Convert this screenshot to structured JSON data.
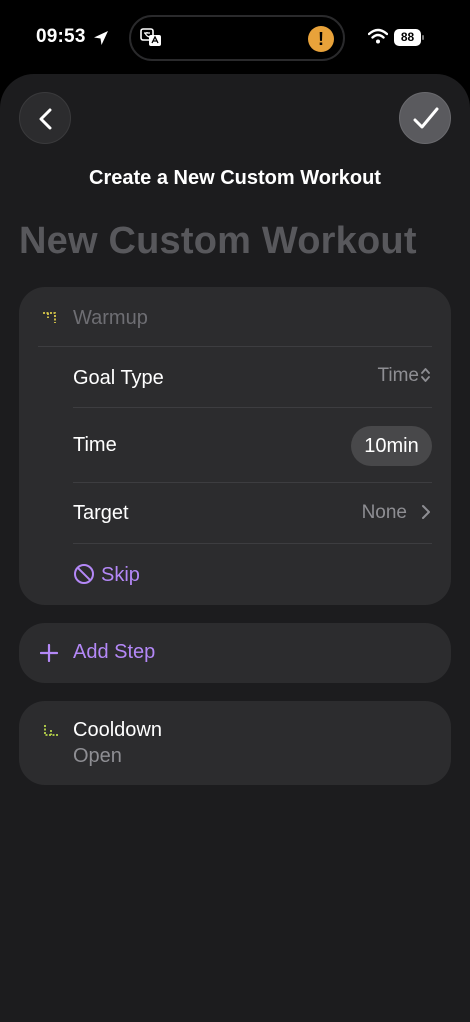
{
  "status_bar": {
    "time": "09:53",
    "battery": "88",
    "icons": [
      "location-arrow-icon",
      "translate-icon",
      "alert-icon",
      "wifi-icon",
      "battery-icon"
    ]
  },
  "nav": {
    "back_icon": "chevron-left-icon",
    "done_icon": "checkmark-icon"
  },
  "sheet_title": "Create a New Custom Workout",
  "workout_name": "New Custom Workout",
  "warmup": {
    "label": "Warmup",
    "rows": {
      "goal_type": {
        "label": "Goal Type",
        "value": "Time"
      },
      "time": {
        "label": "Time",
        "value": "10min"
      },
      "target": {
        "label": "Target",
        "value": "None"
      }
    },
    "skip_label": "Skip"
  },
  "add_step": {
    "label": "Add Step"
  },
  "cooldown": {
    "title": "Cooldown",
    "subtitle": "Open"
  },
  "colors": {
    "accent": "#b488f7",
    "warmup_icon": "#d9c94a",
    "cooldown_icon": "#b8d64a",
    "card": "#2c2c2e",
    "sheet": "#1c1c1e"
  }
}
